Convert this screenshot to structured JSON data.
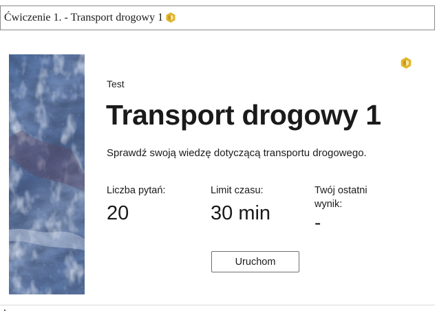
{
  "exercise": {
    "title": "Ćwiczenie 1. - Transport drogowy 1"
  },
  "card": {
    "type_label": "Test",
    "title": "Transport drogowy 1",
    "description": "Sprawdź swoją wiedzę dotyczącą transportu drogowego.",
    "stats": [
      {
        "label": "Liczba pytań:",
        "value": "20"
      },
      {
        "label": "Limit czasu:",
        "value": "30 min"
      },
      {
        "label": "Twój ostatni wynik:",
        "value": "-"
      }
    ],
    "start_button_label": "Uruchom"
  },
  "colors": {
    "badge": "#e1b52b",
    "badge_inner": "#f6e9a9",
    "image_base": "#5f7ba8"
  },
  "icons": {
    "badge": "hexagon-badge-icon"
  }
}
